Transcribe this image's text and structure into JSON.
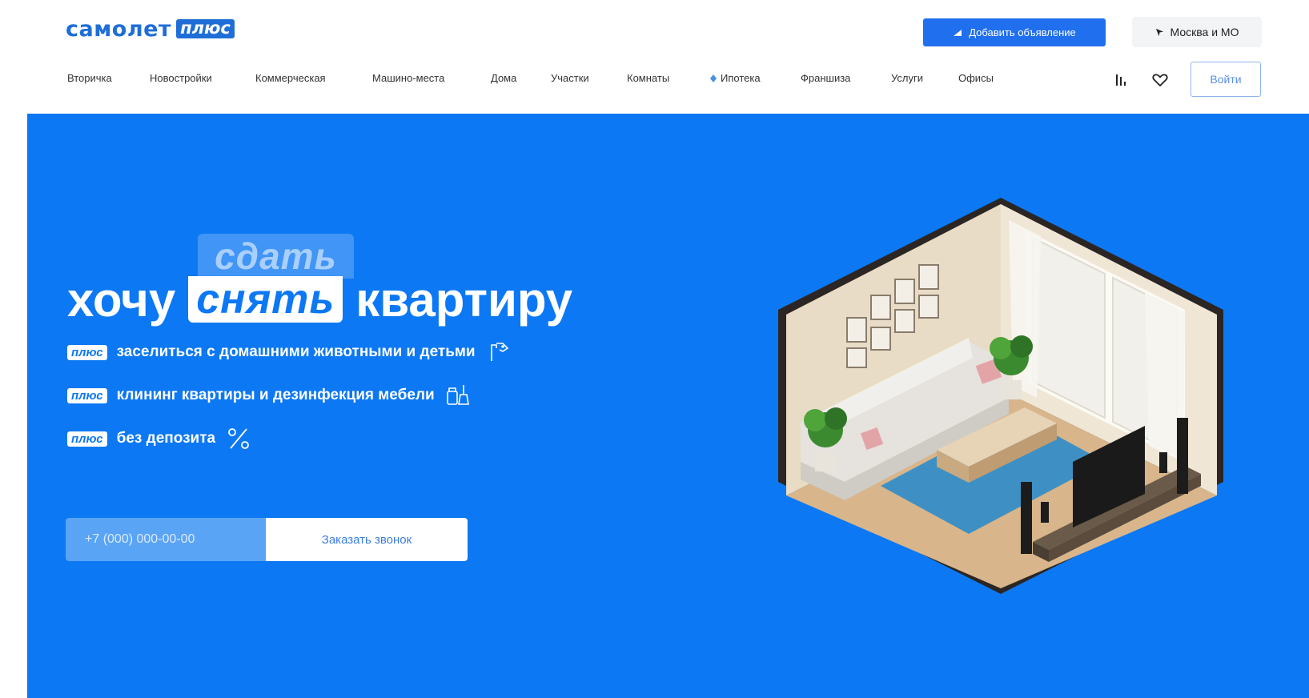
{
  "logo": {
    "word": "самолет",
    "badge": "плюс"
  },
  "header": {
    "add_listing_label": "Добавить объявление",
    "city_label": "Москва и МО",
    "login_label": "Войти"
  },
  "nav": {
    "items": [
      {
        "label": "Вторичка"
      },
      {
        "label": "Новостройки"
      },
      {
        "label": "Коммерческая"
      },
      {
        "label": "Машино-места"
      },
      {
        "label": "Дома"
      },
      {
        "label": "Участки"
      },
      {
        "label": "Комнаты"
      },
      {
        "label": "Ипотека",
        "icon": "diamond-icon"
      },
      {
        "label": "Франшиза"
      },
      {
        "label": "Услуги"
      },
      {
        "label": "Офисы"
      }
    ]
  },
  "icons": {
    "compare": "compare-icon",
    "favorites": "heart-icon",
    "add": "megaphone-icon",
    "location": "location-arrow-icon"
  },
  "hero": {
    "alt_action": "сдать",
    "prefix": "хочу",
    "selected_action": "снять",
    "suffix": "квартиру",
    "benefits": [
      {
        "badge": "плюс",
        "text": "заселиться с домашними животными и детьми",
        "icon": "pet-icon"
      },
      {
        "badge": "плюс",
        "text": "клининг квартиры и дезинфекция мебели",
        "icon": "cleaning-icon"
      },
      {
        "badge": "плюс",
        "text": "без депозита",
        "icon": "percent-icon"
      }
    ],
    "phone_placeholder": "+7 (000) 000-00-00",
    "call_button_label": "Заказать звонок"
  },
  "colors": {
    "brand_blue": "#1f6ed8",
    "hero_blue": "#0c78f4",
    "button_blue": "#1f6fee"
  }
}
